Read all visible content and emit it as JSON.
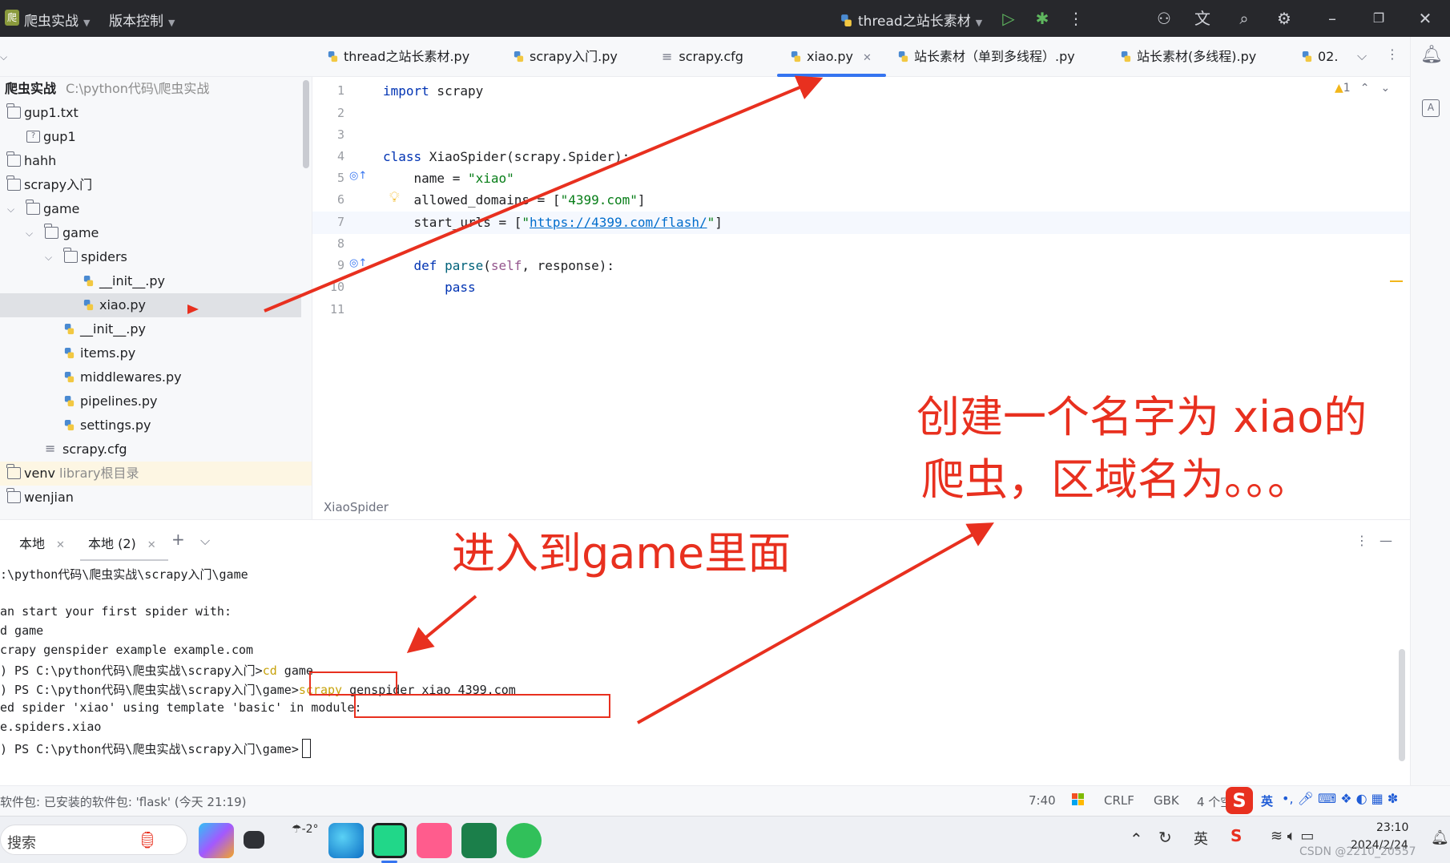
{
  "titlebar": {
    "project_badge": "爬",
    "project_name": "爬虫实战",
    "vcs_label": "版本控制",
    "run_config": "thread之站长素材"
  },
  "tabs": [
    {
      "label": "thread之站长素材.py",
      "icon": "python-file-icon"
    },
    {
      "label": "scrapy入门.py",
      "icon": "python-file-icon"
    },
    {
      "label": "scrapy.cfg",
      "icon": "config-file-icon"
    },
    {
      "label": "xiao.py",
      "icon": "python-file-icon",
      "active": true
    },
    {
      "label": "站长素材（单到多线程）.py",
      "icon": "python-file-icon"
    },
    {
      "label": "站长素材(多线程).py",
      "icon": "python-file-icon"
    },
    {
      "label": "02.",
      "icon": "python-file-icon"
    }
  ],
  "tree": {
    "root_name": "爬虫实战",
    "root_path": "C:\\python代码\\爬虫实战",
    "items": [
      {
        "label": "gup1.txt",
        "type": "folder"
      },
      {
        "label": "gup1",
        "type": "unknown"
      },
      {
        "label": "hahh",
        "type": "folder"
      },
      {
        "label": "scrapy入门",
        "type": "folder"
      },
      {
        "label": "game",
        "type": "folder"
      },
      {
        "label": "game",
        "type": "package"
      },
      {
        "label": "spiders",
        "type": "package"
      },
      {
        "label": "__init__.py",
        "type": "python"
      },
      {
        "label": "xiao.py",
        "type": "python",
        "selected": true
      },
      {
        "label": "__init__.py",
        "type": "python"
      },
      {
        "label": "items.py",
        "type": "python"
      },
      {
        "label": "middlewares.py",
        "type": "python"
      },
      {
        "label": "pipelines.py",
        "type": "python"
      },
      {
        "label": "settings.py",
        "type": "python"
      },
      {
        "label": "scrapy.cfg",
        "type": "config"
      },
      {
        "label": "venv",
        "type": "folder",
        "note": "library根目录"
      },
      {
        "label": "wenjian",
        "type": "folder"
      }
    ]
  },
  "editor": {
    "line_numbers": [
      "1",
      "2",
      "3",
      "4",
      "5",
      "6",
      "7",
      "8",
      "9",
      "10",
      "11"
    ],
    "lines": {
      "l1_kw": "import",
      "l1_rest": " scrapy",
      "l4_kw": "class",
      "l4_rest": " XiaoSpider(scrapy.Spider):",
      "l5_a": "    name = ",
      "l5_s": "\"xiao\"",
      "l6_a": "    allowed_domains = [",
      "l6_s": "\"4399.com\"",
      "l6_b": "]",
      "l7_a": "    start_urls = [",
      "l7_q1": "\"",
      "l7_url": "https://4399.com/flash/",
      "l7_q2": "\"",
      "l7_b": "]",
      "l9_kw": "    def",
      "l9_fn": " parse",
      "l9_p1": "(",
      "l9_self": "self",
      "l9_p2": ", response):",
      "l10_kw": "        pass"
    },
    "warning_count": "1",
    "breadcrumb": "XiaoSpider"
  },
  "terminal": {
    "tabs": [
      {
        "label": "本地"
      },
      {
        "label": "本地 (2)"
      }
    ],
    "lines": [
      ":\\python代码\\爬虫实战\\scrapy入门\\game",
      "",
      "an start your first spider with:",
      "d game",
      "crapy genspider example example.com",
      ") PS C:\\python代码\\爬虫实战\\scrapy入门>",
      ") PS C:\\python代码\\爬虫实战\\scrapy入门\\game>",
      "ed spider 'xiao' using template 'basic' in module:",
      "e.spiders.xiao",
      ") PS C:\\python代码\\爬虫实战\\scrapy入门\\game>"
    ],
    "cmd1_kw": "cd",
    "cmd1_rest": " game",
    "cmd2_kw": "scrapy",
    "cmd2_rest": " genspider xiao 4399.com"
  },
  "statusbar": {
    "message": "软件包: 已安装的软件包: 'flask' (今天 21:19)",
    "position": "7:40",
    "line_sep": "CRLF",
    "encoding": "GBK",
    "indent": "4 个空"
  },
  "taskbar": {
    "search_placeholder": "搜索",
    "weather": "-2°",
    "ime_label": "英",
    "time": "23:10",
    "date": "2024/2/24",
    "watermark": "CSDN @2210_20557"
  },
  "annotations": {
    "enter_game": "进入到game里面",
    "create_line1": "创建一个名字为 xiao的",
    "create_line2": "爬虫，区域名为。。。"
  },
  "colors": {
    "accent": "#3574f0",
    "annotation_red": "#e8301f",
    "titlebar_bg": "#27282c"
  }
}
